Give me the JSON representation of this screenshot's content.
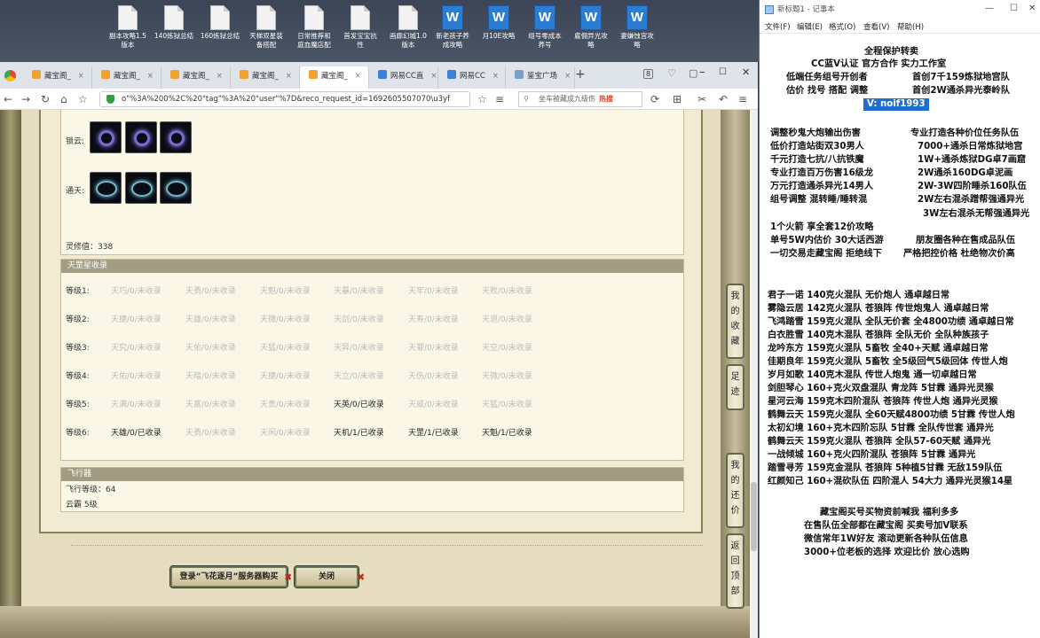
{
  "desktop": {
    "icons": [
      {
        "type": "doc",
        "label": "副本攻略1.5\n版本"
      },
      {
        "type": "doc",
        "label": "140炼狱总结"
      },
      {
        "type": "doc",
        "label": "160炼狱总结"
      },
      {
        "type": "doc",
        "label": "天梯双星装\n备搭配"
      },
      {
        "type": "doc",
        "label": "日常推荐和\n庭血魔店配"
      },
      {
        "type": "doc",
        "label": "首发宝宝抗\n性"
      },
      {
        "type": "doc",
        "label": "画廊幻城1.0\n版本"
      },
      {
        "type": "word",
        "label": "新老孩子养\n成攻略"
      },
      {
        "type": "word",
        "label": "月10E攻略"
      },
      {
        "type": "word",
        "label": "组号零成本\n养号"
      },
      {
        "type": "word",
        "label": "雇佣异光攻\n略"
      },
      {
        "type": "word",
        "label": "妻嫌蚀宫攻\n略"
      }
    ]
  },
  "browser": {
    "tabs": [
      {
        "label": "藏宝阁_",
        "active": false
      },
      {
        "label": "藏宝阁_",
        "active": false
      },
      {
        "label": "藏宝阁_",
        "active": false
      },
      {
        "label": "藏宝阁_",
        "active": false
      },
      {
        "label": "藏宝阁_",
        "active": true
      },
      {
        "label": "网易CC直",
        "active": false
      },
      {
        "label": "网易CC",
        "active": false
      },
      {
        "label": "鉴宝广场",
        "active": false
      }
    ],
    "tab_count": "8",
    "url": "o\"%3A%200%2C%20\"tag\"%3A%20\"user\"%7D&reco_request_id=1692605507070\\u3yf",
    "search_placeholder": "坐车被藏成九级伤",
    "search_hot": "热搜"
  },
  "page": {
    "slots": [
      {
        "label": "锁云:",
        "kind": "gem"
      },
      {
        "label": "通天:",
        "kind": "ring"
      }
    ],
    "lingxiu": "灵修值：338",
    "tianzhu": {
      "title": "天罡星收录",
      "rows": [
        {
          "label": "等级1:",
          "cells": [
            {
              "t": "天巧/0/未收录",
              "on": false
            },
            {
              "t": "天勇/0/未收录",
              "on": false
            },
            {
              "t": "天魁/0/未收录",
              "on": false
            },
            {
              "t": "天暴/0/未收录",
              "on": false
            },
            {
              "t": "天牢/0/未收录",
              "on": false
            },
            {
              "t": "天败/0/未收录",
              "on": false
            }
          ]
        },
        {
          "label": "等级2:",
          "cells": [
            {
              "t": "天捷/0/未收录",
              "on": false
            },
            {
              "t": "天雄/0/未收录",
              "on": false
            },
            {
              "t": "天微/0/未收录",
              "on": false
            },
            {
              "t": "天剑/0/未收录",
              "on": false
            },
            {
              "t": "天寿/0/未收录",
              "on": false
            },
            {
              "t": "天退/0/未收录",
              "on": false
            }
          ]
        },
        {
          "label": "等级3:",
          "cells": [
            {
              "t": "天究/0/未收录",
              "on": false
            },
            {
              "t": "天佑/0/未收录",
              "on": false
            },
            {
              "t": "天猛/0/未收录",
              "on": false
            },
            {
              "t": "天异/0/未收录",
              "on": false
            },
            {
              "t": "天罪/0/未收录",
              "on": false
            },
            {
              "t": "天空/0/未收录",
              "on": false
            }
          ]
        },
        {
          "label": "等级4:",
          "cells": [
            {
              "t": "天佑/0/未收录",
              "on": false
            },
            {
              "t": "天暗/0/未收录",
              "on": false
            },
            {
              "t": "天捷/0/未收录",
              "on": false
            },
            {
              "t": "天立/0/未收录",
              "on": false
            },
            {
              "t": "天伤/0/未收录",
              "on": false
            },
            {
              "t": "天微/0/未收录",
              "on": false
            }
          ]
        },
        {
          "label": "等级5:",
          "cells": [
            {
              "t": "天满/0/未收录",
              "on": false
            },
            {
              "t": "天富/0/未收录",
              "on": false
            },
            {
              "t": "天贵/0/未收录",
              "on": false
            },
            {
              "t": "天英/0/已收录",
              "on": true
            },
            {
              "t": "天威/0/未收录",
              "on": false
            },
            {
              "t": "天猛/0/未收录",
              "on": false
            }
          ]
        },
        {
          "label": "等级6:",
          "cells": [
            {
              "t": "天雄/0/已收录",
              "on": true
            },
            {
              "t": "天勇/0/未收录",
              "on": false
            },
            {
              "t": "天闲/0/未收录",
              "on": false
            },
            {
              "t": "天机/1/已收录",
              "on": true
            },
            {
              "t": "天罡/1/已收录",
              "on": true
            },
            {
              "t": "天魁/1/已收录",
              "on": true
            }
          ]
        }
      ]
    },
    "flyer": {
      "title": "飞行器",
      "level": "飞行等级：64",
      "cloud": "云霸   5级"
    },
    "login_button": "登录“飞花逐月”服务器购买",
    "close_button": "关闭",
    "side_buttons": [
      "我的收藏",
      "足迹",
      "我的还价",
      "返回顶部"
    ]
  },
  "notepad": {
    "title": "新标题1 - 记事本",
    "menu": [
      "文件(F)",
      "编辑(E)",
      "格式(O)",
      "查看(V)",
      "帮助(H)"
    ],
    "header": [
      "全程保护转卖",
      "CC蓝V认证  官方合作  实力工作室",
      "低端任务组号开创者",
      "首创7千159炼狱地宫队",
      "估价 找号 搭配 调整",
      "首创2W通杀异光泰岭队"
    ],
    "vid": "V:  noif1993",
    "services": [
      [
        "调整秒鬼大炮输出伤害",
        "专业打造各种价位任务队伍"
      ],
      [
        "低价打造站街双30男人",
        "7000+通杀日常炼狱地宫"
      ],
      [
        "千元打造七抗/八抗铁魔",
        "1W+通杀炼狱DG卓7画窟"
      ],
      [
        "专业打造百万伤害16级龙",
        "2W通杀160DG卓泥画"
      ],
      [
        "万元打造通杀异光14男人",
        "2W-3W四阶睡杀160队伍"
      ],
      [
        "组号调整 混转睡/睡转混",
        "2W左右混杀蹭帮强通异光"
      ]
    ],
    "service_last": "3W左右混杀无帮强通异光",
    "tips": [
      "1个火箭 享全套12价攻略",
      "单号5W内估价 30大话西游",
      "朋友圈各种在售成品队伍",
      "一切交易走藏宝阁 拒绝线下",
      "严格把控价格 杜绝物次价高"
    ],
    "teams": [
      "君子一诺 140克火混队 无价炮人 通卓越日常",
      "雾隐云居 142克火混队 苍狼阵 传世炮鬼人 通卓越日常",
      "飞鸿踏雪 159克火混队 全队无价套 全4800功绩 通卓越日常",
      "白衣胜雪 140克木混队 苍狼阵 全队无价 全队种族孩子",
      "龙吟东方 159克火混队 5畜牧 全40+天赋 通卓越日常",
      "佳期良年 159克火混队 5畜牧 全5级回气5级回体 传世人炮",
      "岁月如歌 140克木混队 传世人炮鬼 通一切卓越日常",
      "剑胆琴心 160+克火双盘混队 青龙阵 5甘霖 通异光灵猴",
      "星河云海 159克木四阶混队 苍狼阵 传世人炮 通异光灵猴",
      "鹤舞云天 159克火混队 全60天赋4800功绩 5甘霖 传世人炮",
      "太初幻境 160+克木四阶忘队 5甘霖 全队传世套 通异光",
      "鹤舞云天 159克火混队 苍狼阵 全队57-60天赋 通异光",
      "一战倾城 160+克火四阶混队 苍狼阵 5甘霖 通异光",
      "踏雪寻芳 159克金混队 苍狼阵 5种植5甘霖 无敌159队伍",
      "红颜知己 160+混砍队伍 四阶混人 54大力 通异光灵猴14星"
    ],
    "footer": [
      "藏宝阁买号买物资前喊我 福利多多",
      "在售队伍全部都在藏宝阁 买卖号加V联系",
      "微信常年1W好友 滚动更新各种队伍信息",
      "3000+位老板的选择 欢迎比价 放心选购"
    ]
  }
}
